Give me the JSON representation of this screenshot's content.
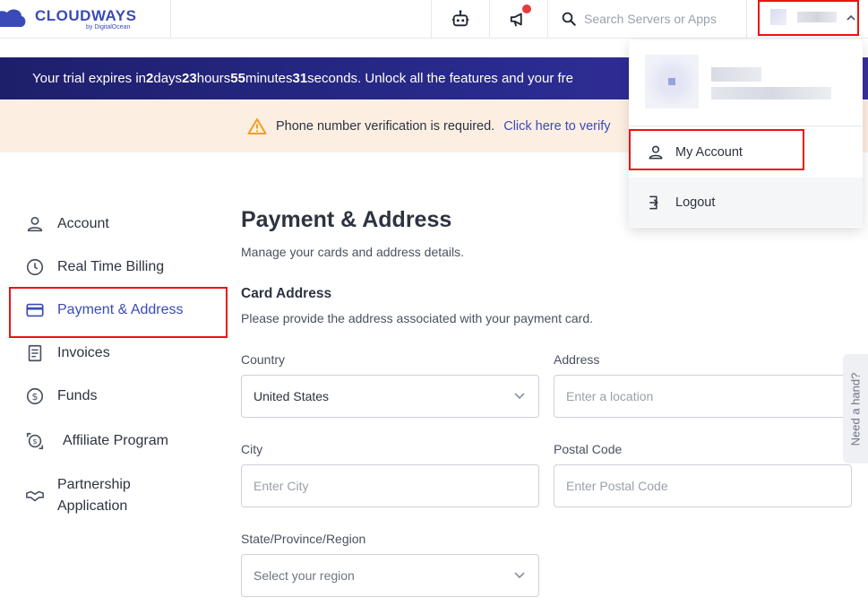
{
  "header": {
    "logo_text": "CLOUDWAYS",
    "logo_sub": "by DigitalOcean",
    "search_placeholder": "Search Servers or Apps"
  },
  "trial_banner": {
    "prefix": "Your trial expires in ",
    "days": "2",
    "days_label": " days ",
    "hours": "23",
    "hours_label": " hours ",
    "minutes": "55",
    "minutes_label": " minutes ",
    "seconds": "31",
    "suffix": "  seconds. Unlock all the features and your fre"
  },
  "verify_banner": {
    "text": "Phone number verification is required.",
    "link": "Click here to verify"
  },
  "sidebar": {
    "items": [
      {
        "label": "Account"
      },
      {
        "label": "Real Time Billing"
      },
      {
        "label": "Payment & Address"
      },
      {
        "label": "Invoices"
      },
      {
        "label": "Funds"
      },
      {
        "label": "Affiliate Program"
      },
      {
        "label": "Partnership",
        "label2": "Application"
      }
    ]
  },
  "main": {
    "title": "Payment & Address",
    "subtitle": "Manage your cards and address details.",
    "section_title": "Card Address",
    "section_subtitle": "Please provide the address associated with your payment card.",
    "fields": {
      "country_label": "Country",
      "country_value": "United States",
      "address_label": "Address",
      "address_placeholder": "Enter a location",
      "city_label": "City",
      "city_placeholder": "Enter City",
      "postal_label": "Postal Code",
      "postal_placeholder": "Enter Postal Code",
      "state_label": "State/Province/Region",
      "state_placeholder": "Select your region"
    }
  },
  "help_tab": {
    "label": "Need a hand?"
  },
  "user_menu": {
    "my_account": "My Account",
    "logout": "Logout"
  },
  "colors": {
    "brand": "#3a4bb8",
    "highlight": "#e11111",
    "banner_bg": "#1e1f6b",
    "verify_bg": "#fdeee2"
  }
}
